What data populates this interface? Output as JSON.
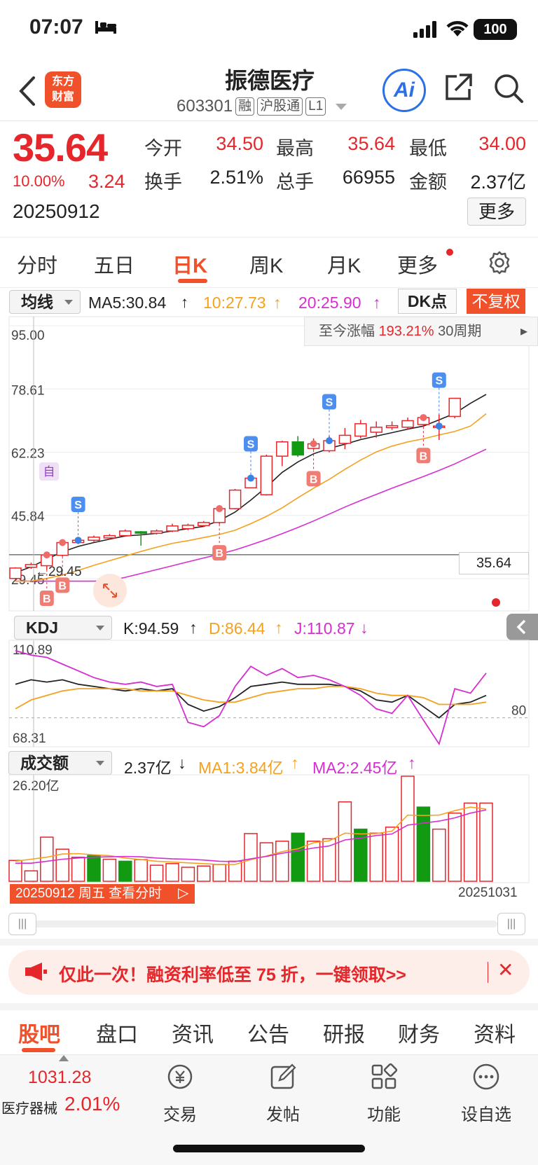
{
  "status": {
    "time": "07:07",
    "battery": "100"
  },
  "header": {
    "logo_line1": "东方",
    "logo_line2": "财富",
    "title": "振德医疗",
    "code": "603301",
    "tags": [
      "融",
      "沪股通",
      "L1"
    ],
    "ai_label": "Ai"
  },
  "quote": {
    "price": "35.64",
    "change_pct": "10.00%",
    "change_amt": "3.24",
    "date": "20250912",
    "open_label": "今开",
    "open": "34.50",
    "high_label": "最高",
    "high": "35.64",
    "low_label": "最低",
    "low": "34.00",
    "turnover_label": "换手",
    "turnover": "2.51%",
    "volume_label": "总手",
    "volume": "66955",
    "amount_label": "金额",
    "amount": "2.37亿",
    "more": "更多"
  },
  "period_tabs": [
    "分时",
    "五日",
    "日K",
    "周K",
    "月K",
    "更多"
  ],
  "active_period": "日K",
  "ma_row": {
    "select": "均线",
    "ma5": "MA5:30.84",
    "ma10": "10:27.73",
    "ma20": "20:25.90",
    "dk": "DK点",
    "fq": "不复权"
  },
  "range_box": {
    "label": "至今涨幅",
    "value": "193.21%",
    "period": "30周期"
  },
  "kdj_row": {
    "select": "KDJ",
    "k": "K:94.59",
    "d": "D:86.44",
    "j": "J:110.87"
  },
  "vol_row": {
    "select": "成交额",
    "val": "2.37亿",
    "ma1": "MA1:3.84亿",
    "ma2": "MA2:2.45亿"
  },
  "chart_data": [
    {
      "type": "candlestick",
      "y_ticks": [
        "95.00",
        "78.61",
        "62.23",
        "45.84",
        "29.45"
      ],
      "ylim": [
        29.45,
        95.0
      ],
      "current_price": "35.64",
      "min_label": "29.45",
      "candles": [
        [
          29.5,
          32.2,
          29.2,
          32.4
        ],
        [
          32.4,
          33.1,
          32.0,
          33.6
        ],
        [
          32.8,
          35.6,
          31.8,
          35.6
        ],
        [
          35.5,
          38.8,
          35.2,
          39.2
        ],
        [
          38.8,
          39.4,
          38.4,
          39.8
        ],
        [
          39.4,
          40.2,
          39.0,
          40.6
        ],
        [
          40.0,
          40.6,
          39.6,
          41.0
        ],
        [
          40.6,
          41.8,
          40.3,
          42.2
        ],
        [
          41.6,
          41.3,
          38.0,
          41.8
        ],
        [
          41.2,
          41.8,
          40.9,
          42.2
        ],
        [
          41.8,
          43.1,
          41.5,
          43.7
        ],
        [
          42.4,
          43.3,
          42.0,
          43.7
        ],
        [
          43.2,
          44.0,
          42.8,
          44.4
        ],
        [
          44.0,
          47.6,
          43.6,
          48.2
        ],
        [
          47.6,
          52.4,
          47.4,
          52.7
        ],
        [
          53.0,
          55.5,
          53.0,
          55.5
        ],
        [
          51.2,
          61.2,
          51.0,
          61.6
        ],
        [
          61.2,
          64.9,
          58.6,
          65.2
        ],
        [
          64.9,
          61.5,
          61.0,
          66.4
        ],
        [
          63.2,
          64.4,
          62.8,
          65.8
        ],
        [
          62.6,
          65.2,
          62.2,
          66.4
        ],
        [
          64.5,
          66.6,
          63.0,
          68.5
        ],
        [
          66.4,
          69.6,
          65.8,
          70.6
        ],
        [
          67.4,
          68.7,
          66.0,
          70.2
        ],
        [
          68.6,
          69.1,
          68.0,
          70.2
        ],
        [
          68.7,
          70.4,
          68.2,
          71.2
        ],
        [
          69.4,
          71.2,
          68.8,
          72.0
        ],
        [
          69.0,
          69.0,
          65.4,
          72.0
        ],
        [
          71.5,
          76.2,
          71.0,
          76.2
        ]
      ],
      "ma5": [
        31.0,
        32.5,
        34.5,
        36.4,
        37.8,
        38.8,
        39.7,
        40.5,
        40.8,
        41.2,
        41.8,
        42.4,
        43.0,
        44.5,
        46.7,
        49.8,
        53.2,
        57.0,
        59.7,
        61.8,
        63.2,
        64.3,
        65.5,
        66.4,
        67.3,
        68.2,
        69.0,
        70.6,
        72.3,
        74.9,
        77.2
      ],
      "ma10": [
        28.8,
        28.8,
        29.5,
        30.4,
        31.6,
        32.9,
        34.1,
        35.3,
        36.5,
        37.6,
        38.6,
        39.3,
        40.1,
        40.9,
        42.0,
        43.7,
        45.6,
        47.8,
        50.4,
        52.9,
        55.2,
        57.8,
        60.2,
        62.3,
        63.8,
        64.9,
        65.7,
        66.7,
        67.6,
        69.0,
        72.2
      ],
      "ma20": [
        28.8,
        28.8,
        28.8,
        28.8,
        28.8,
        28.8,
        28.9,
        29.8,
        30.8,
        31.8,
        32.8,
        33.8,
        34.8,
        35.8,
        36.9,
        38.2,
        39.6,
        41.1,
        42.7,
        44.4,
        46.2,
        48.0,
        49.7,
        51.3,
        52.9,
        54.4,
        55.9,
        57.5,
        59.2,
        61.1,
        63.0
      ],
      "marks": [
        {
          "label": "B",
          "type": "buy",
          "index": 2
        },
        {
          "label": "B",
          "type": "buy",
          "index": 3
        },
        {
          "label": "S",
          "type": "sell",
          "index": 4
        },
        {
          "label": "B",
          "type": "buy",
          "index": 13
        },
        {
          "label": "S",
          "type": "sell",
          "index": 15
        },
        {
          "label": "B",
          "type": "buy",
          "index": 19
        },
        {
          "label": "S",
          "type": "sell",
          "index": 20
        },
        {
          "label": "B",
          "type": "buy",
          "index": 26
        },
        {
          "label": "S",
          "type": "sell",
          "index": 27
        }
      ],
      "self_mark": "自"
    },
    {
      "type": "line",
      "y_ticks": [
        "110.89",
        "68.31"
      ],
      "ref_line": "80",
      "series": [
        {
          "name": "K",
          "color": "#222222",
          "values": [
            95,
            97,
            96,
            97,
            95,
            94,
            93,
            92,
            93,
            92,
            93,
            86,
            83,
            85,
            89,
            94,
            95,
            96,
            95,
            95,
            95,
            94,
            92,
            88,
            87,
            90,
            85,
            80,
            86,
            87,
            90
          ]
        },
        {
          "name": "D",
          "color": "#f4a11f",
          "values": [
            84,
            88,
            90,
            92,
            93,
            93,
            93,
            93,
            92,
            92,
            92,
            90,
            88,
            87,
            87,
            89,
            91,
            92,
            93,
            93,
            94,
            94,
            93,
            91,
            90,
            90,
            89,
            86,
            86,
            86,
            87
          ]
        },
        {
          "name": "J",
          "color": "#d62ed0",
          "values": [
            110,
            108,
            107,
            104,
            101,
            98,
            96,
            95,
            96,
            94,
            95,
            78,
            76,
            81,
            94,
            103,
            99,
            102,
            98,
            99,
            97,
            94,
            90,
            84,
            82,
            90,
            79,
            68,
            93,
            91,
            100
          ]
        }
      ]
    },
    {
      "type": "bar",
      "y_ticks": [
        "26.20亿"
      ],
      "ylim": [
        0,
        26.2
      ],
      "values": [
        5.2,
        2.6,
        11.0,
        8.0,
        6.0,
        6.4,
        5.5,
        5.0,
        5.4,
        4.0,
        4.4,
        3.5,
        3.8,
        4.2,
        5.0,
        11.9,
        9.6,
        10.0,
        12.0,
        10.0,
        10.6,
        19.8,
        13.0,
        12.0,
        13.5,
        26.2,
        18.5,
        13.0,
        17.0,
        19.5,
        19.5
      ],
      "down": [
        false,
        false,
        false,
        false,
        false,
        true,
        false,
        true,
        false,
        false,
        false,
        false,
        false,
        false,
        false,
        false,
        false,
        false,
        true,
        false,
        false,
        false,
        true,
        false,
        false,
        false,
        true,
        false,
        false,
        false,
        false
      ],
      "ma1": [
        5.0,
        5.5,
        6.0,
        6.8,
        6.9,
        6.6,
        6.4,
        5.8,
        5.4,
        5.0,
        4.8,
        4.6,
        4.4,
        4.2,
        4.2,
        5.4,
        6.3,
        7.4,
        8.1,
        9.6,
        10.1,
        12.0,
        11.8,
        11.9,
        12.5,
        16.5,
        16.4,
        16.5,
        17.6,
        18.5,
        18.0
      ],
      "ma2": [
        4.5,
        4.5,
        5.0,
        5.5,
        5.8,
        6.0,
        6.1,
        6.2,
        6.1,
        5.8,
        5.6,
        5.5,
        5.3,
        5.0,
        4.9,
        5.6,
        6.2,
        7.0,
        7.6,
        8.3,
        8.8,
        10.3,
        10.8,
        11.4,
        11.8,
        14.0,
        14.5,
        15.0,
        15.8,
        17.0,
        17.8
      ]
    }
  ],
  "date_banner": "20250912 周五 查看分时",
  "end_date": "20251031",
  "promo": {
    "text": "仅此一次！融资利率低至 75 折，一键领取>>"
  },
  "content_tabs": [
    "股吧",
    "盘口",
    "资讯",
    "公告",
    "研报",
    "财务",
    "资料"
  ],
  "bottom": {
    "sector_value": "1031.28",
    "sector_name": "医疗器械",
    "sector_pct": "2.01%",
    "items": [
      {
        "label": "交易",
        "icon": "trade-icon"
      },
      {
        "label": "发帖",
        "icon": "post-icon"
      },
      {
        "label": "功能",
        "icon": "function-icon"
      },
      {
        "label": "设自选",
        "icon": "watchlist-icon"
      }
    ]
  }
}
